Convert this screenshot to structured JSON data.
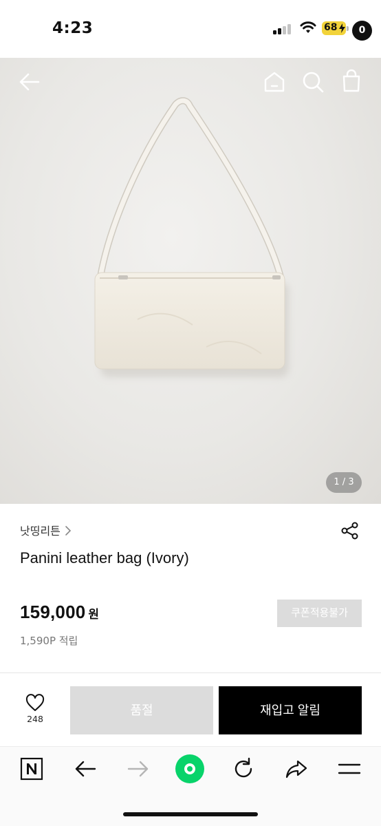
{
  "status_bar": {
    "time": "4:23",
    "battery": "68",
    "icons": [
      "signal-icon",
      "wifi-icon",
      "battery-icon"
    ]
  },
  "hero": {
    "image": "ivory-leather-shoulder-bag-photo",
    "page_indicator": "1 / 3",
    "cart_count": "0",
    "icons": [
      "back-arrow-icon",
      "home-icon",
      "search-icon",
      "cart-icon"
    ]
  },
  "product": {
    "brand": "낫띵리튼",
    "title": "Panini leather bag (Ivory)",
    "price": "159,000",
    "price_unit": "원",
    "coupon_label": "쿠폰적용불가",
    "points": "1,590P 적립"
  },
  "actions": {
    "like_count": "248",
    "soldout_label": "품절",
    "restock_label": "재입고 알림"
  },
  "browser_toolbar": {
    "icons": [
      "naver-n-icon",
      "back-icon",
      "forward-icon",
      "green-dot-icon",
      "refresh-icon",
      "share-arrow-icon",
      "menu-icon"
    ]
  },
  "colors": {
    "accent_green": "#08d36a",
    "disabled_gray": "#dcdcdc",
    "primary_black": "#000000",
    "battery_yellow": "#f2d33a"
  }
}
